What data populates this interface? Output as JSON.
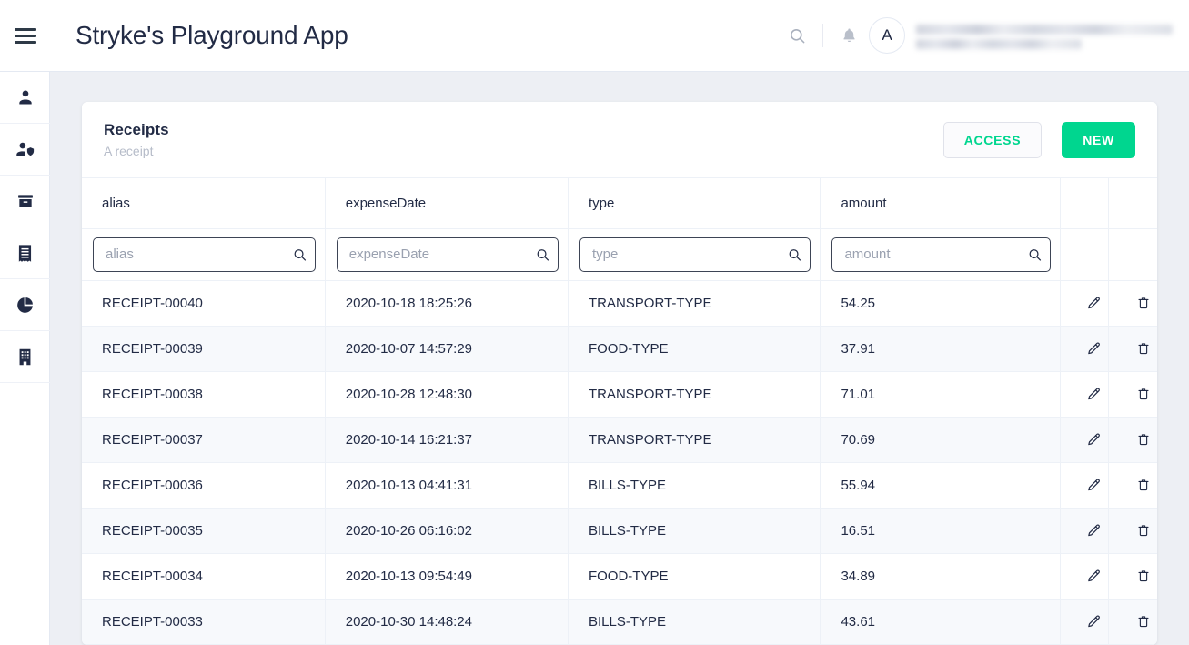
{
  "header": {
    "menu_icon": "hamburger-icon",
    "title": "Stryke's Playground App",
    "search_icon": "search-icon",
    "bell_icon": "bell-icon",
    "avatar_initial": "A",
    "user_name_redacted": "",
    "user_email_redacted": ""
  },
  "sidebar": {
    "items": [
      {
        "icon": "user-icon"
      },
      {
        "icon": "user-shield-icon"
      },
      {
        "icon": "box-archive-icon"
      },
      {
        "icon": "receipt-icon"
      },
      {
        "icon": "pie-chart-icon"
      },
      {
        "icon": "building-icon"
      }
    ]
  },
  "card": {
    "title": "Receipts",
    "subtitle": "A receipt",
    "access_label": "ACCESS",
    "new_label": "NEW",
    "accent_green": "#00d68f",
    "access_text_color": "#00d68f"
  },
  "table": {
    "columns": [
      {
        "key": "alias",
        "header": "alias",
        "placeholder": "alias"
      },
      {
        "key": "expenseDate",
        "header": "expenseDate",
        "placeholder": "expenseDate"
      },
      {
        "key": "type",
        "header": "type",
        "placeholder": "type"
      },
      {
        "key": "amount",
        "header": "amount",
        "placeholder": "amount"
      }
    ],
    "filter_values": {
      "alias": "",
      "expenseDate": "",
      "type": "",
      "amount": ""
    },
    "search_icon": "search-icon",
    "edit_icon": "pencil-icon",
    "delete_icon": "trash-icon",
    "rows": [
      {
        "alias": "RECEIPT-00040",
        "expenseDate": "2020-10-18 18:25:26",
        "type": "TRANSPORT-TYPE",
        "amount": "54.25"
      },
      {
        "alias": "RECEIPT-00039",
        "expenseDate": "2020-10-07 14:57:29",
        "type": "FOOD-TYPE",
        "amount": "37.91"
      },
      {
        "alias": "RECEIPT-00038",
        "expenseDate": "2020-10-28 12:48:30",
        "type": "TRANSPORT-TYPE",
        "amount": "71.01"
      },
      {
        "alias": "RECEIPT-00037",
        "expenseDate": "2020-10-14 16:21:37",
        "type": "TRANSPORT-TYPE",
        "amount": "70.69"
      },
      {
        "alias": "RECEIPT-00036",
        "expenseDate": "2020-10-13 04:41:31",
        "type": "BILLS-TYPE",
        "amount": "55.94"
      },
      {
        "alias": "RECEIPT-00035",
        "expenseDate": "2020-10-26 06:16:02",
        "type": "BILLS-TYPE",
        "amount": "16.51"
      },
      {
        "alias": "RECEIPT-00034",
        "expenseDate": "2020-10-13 09:54:49",
        "type": "FOOD-TYPE",
        "amount": "34.89"
      },
      {
        "alias": "RECEIPT-00033",
        "expenseDate": "2020-10-30 14:48:24",
        "type": "BILLS-TYPE",
        "amount": "43.61"
      }
    ]
  }
}
